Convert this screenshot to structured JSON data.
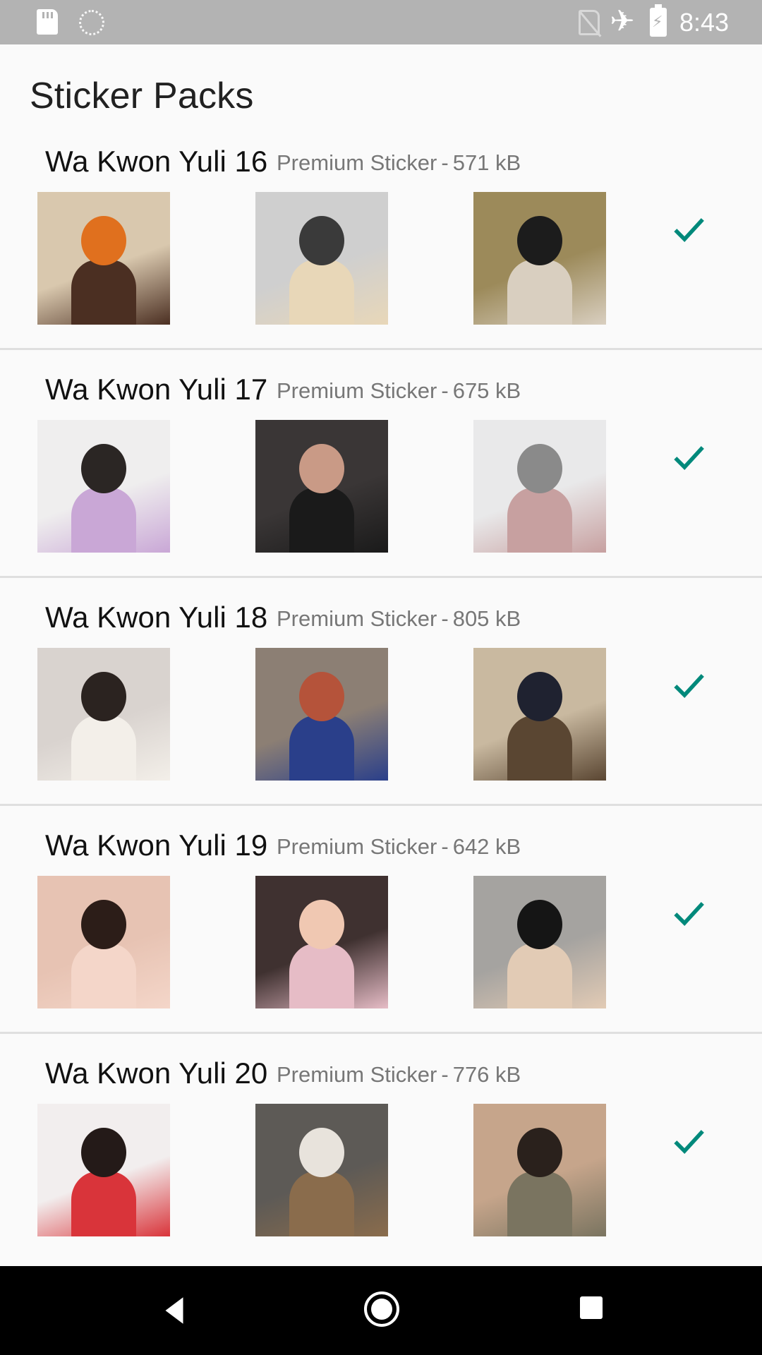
{
  "status_bar": {
    "time": "8:43",
    "icons": [
      "sd-card-icon",
      "sync-icon",
      "no-sim-icon",
      "airplane-mode-icon",
      "battery-charging-icon"
    ]
  },
  "header": {
    "title": "Sticker Packs"
  },
  "packs": [
    {
      "name": "Wa Kwon Yuli 16",
      "publisher": "Premium Sticker",
      "separator": "-",
      "size": "571 kB",
      "added": true,
      "thumbnails": [
        {
          "bg": "#d9c8ae",
          "accent": "#e0701e",
          "detail": "#4b2f22"
        },
        {
          "bg": "#cfcfcf",
          "accent": "#3a3a3a",
          "detail": "#e8d7b8"
        },
        {
          "bg": "#9c8a5a",
          "accent": "#1c1c1c",
          "detail": "#d9cfc0"
        }
      ]
    },
    {
      "name": "Wa Kwon Yuli 17",
      "publisher": "Premium Sticker",
      "separator": "-",
      "size": "675 kB",
      "added": true,
      "thumbnails": [
        {
          "bg": "#efeeee",
          "accent": "#2b2624",
          "detail": "#c9a7d6"
        },
        {
          "bg": "#3a3636",
          "accent": "#c99a86",
          "detail": "#1a1a1a"
        },
        {
          "bg": "#e9e9ea",
          "accent": "#8a8a8a",
          "detail": "#c7a0a0"
        }
      ]
    },
    {
      "name": "Wa Kwon Yuli 18",
      "publisher": "Premium Sticker",
      "separator": "-",
      "size": "805 kB",
      "added": true,
      "thumbnails": [
        {
          "bg": "#d9d3cf",
          "accent": "#2b2320",
          "detail": "#f3efe9"
        },
        {
          "bg": "#8c7f74",
          "accent": "#b5533a",
          "detail": "#2a3f8a"
        },
        {
          "bg": "#c9b9a0",
          "accent": "#1f2230",
          "detail": "#5a4632"
        }
      ]
    },
    {
      "name": "Wa Kwon Yuli 19",
      "publisher": "Premium Sticker",
      "separator": "-",
      "size": "642 kB",
      "added": true,
      "thumbnails": [
        {
          "bg": "#e7c3b3",
          "accent": "#2c1d18",
          "detail": "#f4d6c9"
        },
        {
          "bg": "#3f3130",
          "accent": "#f0c8b2",
          "detail": "#e6bcc6"
        },
        {
          "bg": "#a5a3a0",
          "accent": "#151515",
          "detail": "#e2cbb5"
        }
      ]
    },
    {
      "name": "Wa Kwon Yuli 20",
      "publisher": "Premium Sticker",
      "separator": "-",
      "size": "776 kB",
      "added": true,
      "thumbnails": [
        {
          "bg": "#f2eeee",
          "accent": "#241a18",
          "detail": "#d9343a"
        },
        {
          "bg": "#5d5a56",
          "accent": "#e8e3dc",
          "detail": "#8a6c4c"
        },
        {
          "bg": "#c6a58b",
          "accent": "#2a211c",
          "detail": "#7a7460"
        }
      ]
    }
  ],
  "nav_bar": {
    "buttons": [
      "back-icon",
      "home-icon",
      "recents-icon"
    ]
  },
  "colors": {
    "status_bar": "#b3b3b3",
    "check": "#00897b",
    "divider": "#dfdfdf",
    "background": "#fafafa"
  }
}
